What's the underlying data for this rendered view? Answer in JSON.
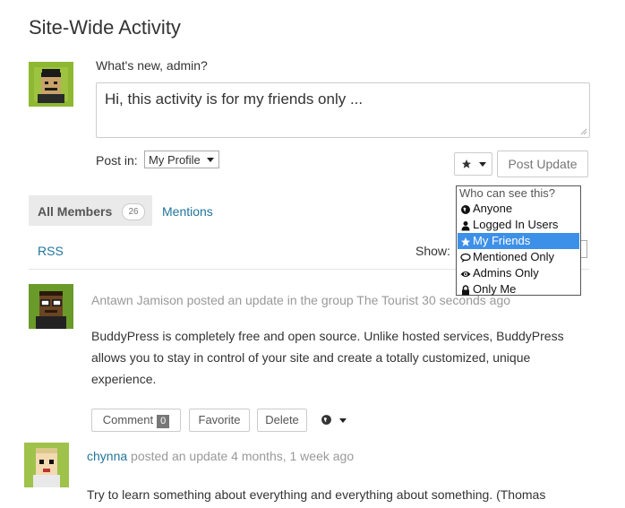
{
  "page": {
    "title": "Site-Wide Activity"
  },
  "post_form": {
    "prompt": "What's new, admin?",
    "text": "Hi, this activity is for my friends only ...",
    "post_in_label": "Post in:",
    "post_in_value": "My Profile",
    "privacy_icon": "star-icon",
    "submit_label": "Post Update"
  },
  "privacy_dropdown": {
    "header": "Who can see this?",
    "options": [
      {
        "label": "Anyone",
        "icon": "globe-icon"
      },
      {
        "label": "Logged In Users",
        "icon": "user-icon"
      },
      {
        "label": "My Friends",
        "icon": "star-icon",
        "selected": true
      },
      {
        "label": "Mentioned Only",
        "icon": "speech-bubble-icon"
      },
      {
        "label": "Admins Only",
        "icon": "eye-icon"
      },
      {
        "label": "Only Me",
        "icon": "lock-icon"
      }
    ]
  },
  "tabs": {
    "all_members_label": "All Members",
    "all_members_count": "26",
    "mentions_label": "Mentions"
  },
  "filter_bar": {
    "rss_label": "RSS",
    "show_label": "Show:"
  },
  "activities": [
    {
      "header": "Antawn Jamison posted an update in the group The Tourist 30 seconds ago",
      "body": "BuddyPress is completely free and open source. Unlike hosted services, Bud­dyPress allows you to stay in control of your site and create a totally customized, unique experience.",
      "comment_label": "Comment",
      "comment_count": "0",
      "favorite_label": "Favorite",
      "delete_label": "Delete"
    },
    {
      "author": "chynna",
      "header_rest": " posted an update 4 months, 1 week ago",
      "body": "Try to learn something about everything and everything about something. (Thomas"
    }
  ],
  "colors": {
    "link": "#21759b",
    "selected": "#3d90e8",
    "avatar_bg": "#8fb832"
  }
}
